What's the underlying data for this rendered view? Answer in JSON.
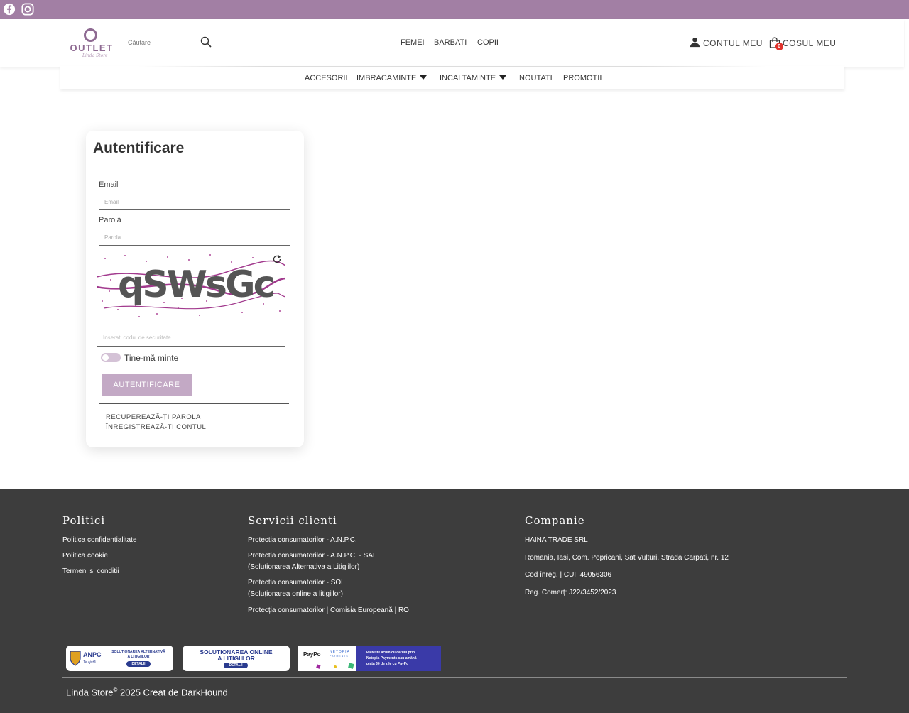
{
  "header": {
    "logo_text": "OUTLET",
    "logo_sub": "Linda Store",
    "search_placeholder": "Căutare",
    "main_nav": [
      "FEMEI",
      "BARBATI",
      "COPII"
    ],
    "account_label": "CONTUL MEU",
    "cart_label": "COSUL MEU",
    "cart_count": "0"
  },
  "subnav": {
    "items": [
      "ACCESORII",
      "IMBRACAMINTE",
      "INCALTAMINTE",
      "NOUTATI",
      "PROMOTII"
    ]
  },
  "login": {
    "title": "Autentificare",
    "email_label": "Email",
    "email_placeholder": "Email",
    "password_label": "Parolă",
    "password_placeholder": "Parola",
    "captcha_text": "qSWsGc",
    "code_placeholder": "Inserati codul de securitate",
    "remember_label": "Tine-mă minte",
    "submit_label": "AUTENTIFICARE",
    "recover_link": "RECUPEREAZĂ-ȚI PAROLA",
    "register_link": "ÎNREGISTREAZĂ-TI CONTUL"
  },
  "footer": {
    "col1_title": "Politici",
    "col1_links": [
      "Politica confidentialitate",
      "Politica cookie",
      "Termeni si conditii"
    ],
    "col2_title": "Servicii clienti",
    "col2_links": [
      "Protectia consumatorilor - A.N.P.C.",
      "Protectia consumatorilor - A.N.P.C. - SAL",
      "(Solutionarea Alternativa a Litigiilor)",
      "Protectia consumatorilor - SOL",
      "(Soluționarea online a litigiilor)",
      "Protecția consumatorilor | Comisia Europeană | RO"
    ],
    "col3_title": "Companie",
    "col3_lines": [
      "HAINA TRADE SRL",
      "Romania, Iasi, Com. Popricani, Sat Vulturi, Strada Carpati, nr. 12",
      "Cod înreg. | CUI: 49056306",
      "Reg. Comerț: J22/3452/2023"
    ],
    "badges": {
      "anpc_title": "ANPC",
      "anpc_sub": "Te ajută",
      "sal_text_1": "SOLUTIONAREA ALTERNATIVĂ",
      "sal_text_2": "A LITIGIILOR",
      "sal_detail": "DETALII",
      "sol_text_1": "SOLUTIONAREA ONLINE",
      "sol_text_2": "A LITIGIILOR",
      "sol_detail": "DETALII",
      "paypo": "PayPo",
      "netopia": "NETOPIA",
      "netopia_sub": "PAYMENTS",
      "paypo_msg_1": "Plătește acum cu cardul prin",
      "paypo_msg_2": "Netopia Payments sau amână",
      "paypo_msg_3": "plata 30 de zile cu PayPo"
    },
    "copyright_brand": "Linda Store",
    "copyright_mark": "©",
    "copyright_rest": " 2025 Creat de DarkHound"
  },
  "colors": {
    "topbar": "#a27fa4",
    "brand": "#8e6a92",
    "button": "#c3a9c5",
    "footer": "#3d3d3d",
    "badge": "#e0332d"
  }
}
